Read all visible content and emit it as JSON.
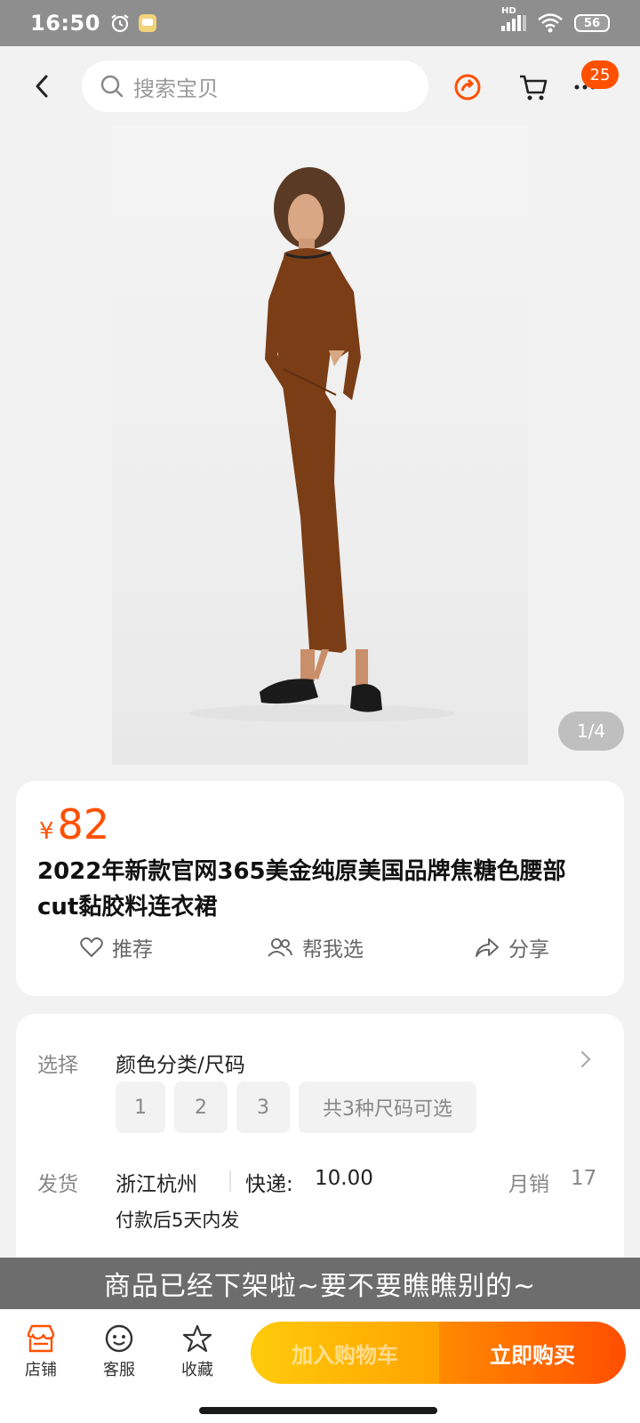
{
  "status_bar": {
    "time": "16:50",
    "network": "HD",
    "battery": "56"
  },
  "search": {
    "placeholder": "搜索宝贝"
  },
  "cart_badge": "25",
  "gallery": {
    "indicator": "1/4"
  },
  "product": {
    "currency": "¥",
    "price": "82",
    "title": "2022年新款官网365美金纯原美国品牌焦糖色腰部cut黏胶料连衣裙",
    "dress_color": "#7a3d16"
  },
  "actions": {
    "recommend": "推荐",
    "help_choose": "帮我选",
    "share": "分享"
  },
  "spec": {
    "select_label": "选择",
    "select_value": "颜色分类/尺码",
    "sizes": [
      "1",
      "2",
      "3"
    ],
    "sizes_summary": "共3种尺码可选",
    "ship_label": "发货",
    "ship_from": "浙江杭州",
    "express_label": "快递:",
    "express_fee": "10.00",
    "monthly_sales_label": "月销",
    "monthly_sales": "17",
    "ship_time": "付款后5天内发"
  },
  "offline_notice": "商品已经下架啦~要不要瞧瞧别的~",
  "bottom_bar": {
    "shop": "店铺",
    "service": "客服",
    "favorite": "收藏",
    "add_to_cart": "加入购物车",
    "buy_now": "立即购买"
  },
  "colors": {
    "accent": "#ff5000",
    "cart_gradient": [
      "#ffcb0b",
      "#ffa200"
    ],
    "buy_gradient": [
      "#ff8a00",
      "#ff4e00"
    ]
  }
}
